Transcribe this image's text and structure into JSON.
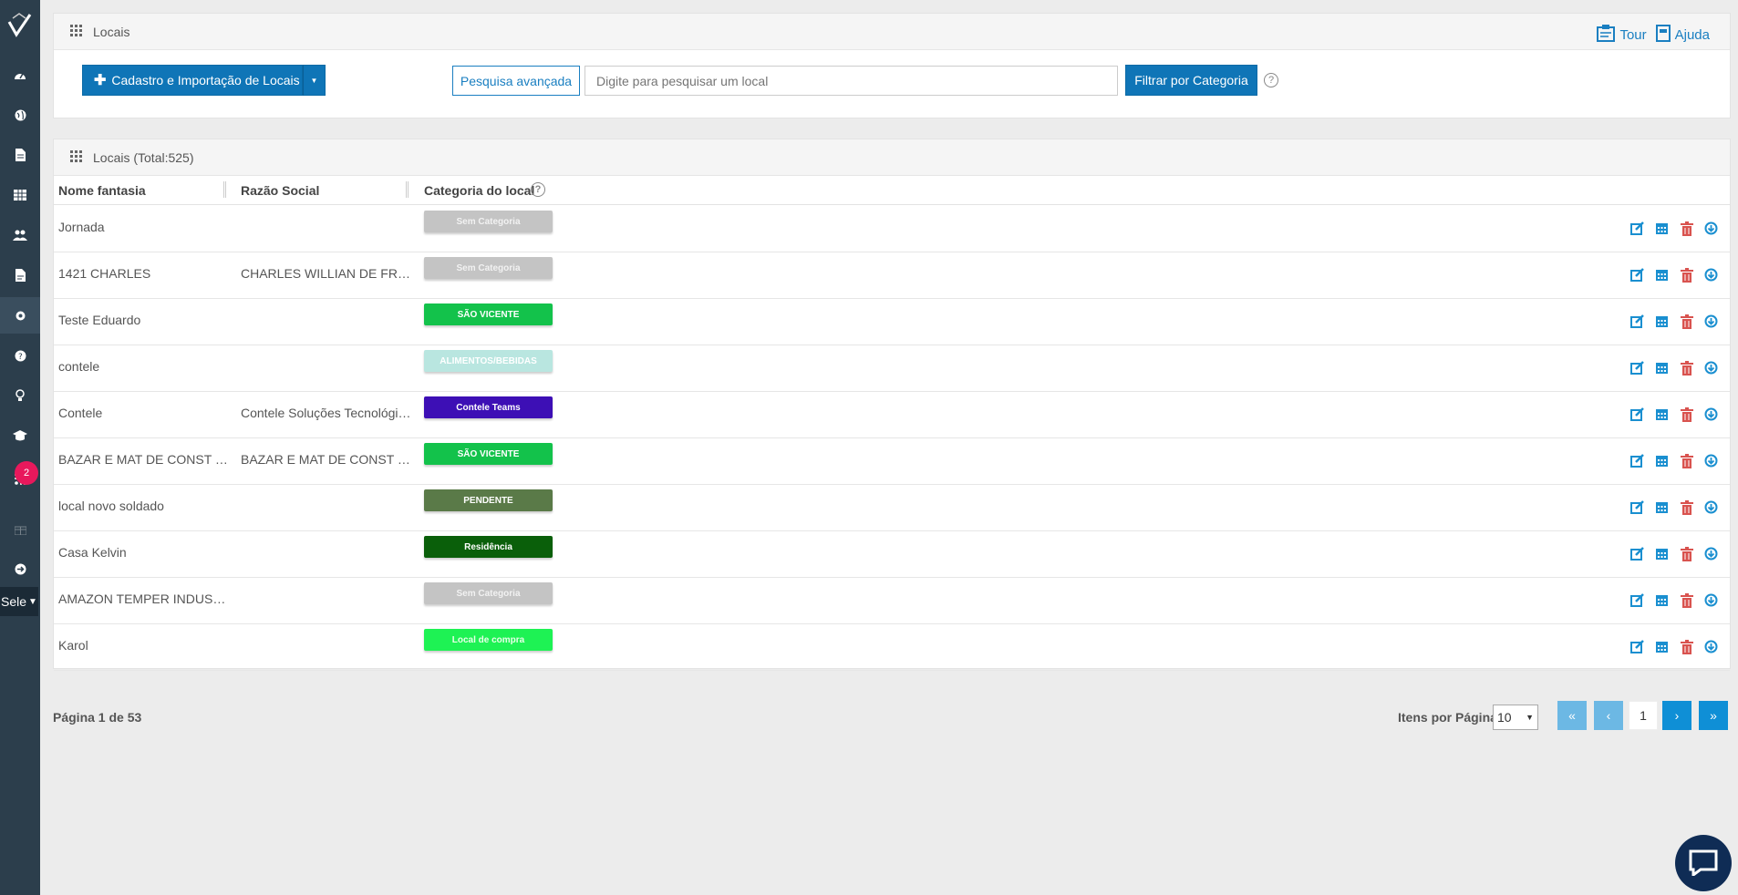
{
  "sidebar": {
    "items": [
      "dashboard-icon",
      "globe-icon",
      "document-icon",
      "table-icon",
      "users-icon",
      "report-icon",
      "gear-icon",
      "help-icon",
      "lightbulb-icon",
      "graduation-icon",
      "rss-icon",
      "gift-icon",
      "logout-icon"
    ],
    "badge": "2",
    "select_value": "Sele"
  },
  "locais_panel": {
    "title": "Locais",
    "tour_label": "Tour",
    "help_label": "Ajuda",
    "add_button_label": "Cadastro e Importação de Locais",
    "advanced_search_label": "Pesquisa avançada",
    "search_placeholder": "Digite para pesquisar um local",
    "filter_button_label": "Filtrar por Categoria"
  },
  "table": {
    "title": "Locais (Total:525)",
    "headers": {
      "name": "Nome fantasia",
      "razao": "Razão Social",
      "categoria": "Categoria do local"
    },
    "rows": [
      {
        "name": "Jornada",
        "razao": "",
        "category": "Sem Categoria",
        "cat_color": "#c4c4c4",
        "cat_text": "#f2f2f2"
      },
      {
        "name": "1421 CHARLES",
        "razao": "CHARLES WILLIAN DE FRANÇA",
        "category": "Sem Categoria",
        "cat_color": "#c4c4c4",
        "cat_text": "#f2f2f2"
      },
      {
        "name": "Teste Eduardo",
        "razao": "",
        "category": "SÃO VICENTE",
        "cat_color": "#13c24b",
        "cat_text": "#ffffff"
      },
      {
        "name": "contele",
        "razao": "",
        "category": "ALIMENTOS/BEBIDAS",
        "cat_color": "#b9e6e0",
        "cat_text": "#ffffff"
      },
      {
        "name": "Contele",
        "razao": "Contele Soluções Tecnológicas",
        "category": "Contele Teams",
        "cat_color": "#3d0fb5",
        "cat_text": "#ffffff"
      },
      {
        "name": "BAZAR E MAT DE CONST MARTINS",
        "razao": "BAZAR E MAT DE CONST MARTINS",
        "category": "SÃO VICENTE",
        "cat_color": "#13c24b",
        "cat_text": "#ffffff"
      },
      {
        "name": "local novo soldado",
        "razao": "",
        "category": "PENDENTE",
        "cat_color": "#5a7a48",
        "cat_text": "#ffffff"
      },
      {
        "name": "Casa Kelvin",
        "razao": "",
        "category": "Residência",
        "cat_color": "#0a5f0a",
        "cat_text": "#ffffff"
      },
      {
        "name": "AMAZON TEMPER INDUSTRIA",
        "razao": "",
        "category": "Sem Categoria",
        "cat_color": "#c4c4c4",
        "cat_text": "#f2f2f2"
      },
      {
        "name": "Karol",
        "razao": "",
        "category": "Local de compra",
        "cat_color": "#1ef254",
        "cat_text": "#e8ffe8"
      }
    ]
  },
  "pagination": {
    "page_info": "Página 1 de 53",
    "items_per_page_label": "Itens por Página:",
    "items_per_page": "10",
    "current_page": "1",
    "first": "«",
    "prev": "‹",
    "next": "›",
    "last": "»"
  },
  "colors": {
    "primary": "#0f75b7",
    "sidebar": "#2c3e4c",
    "edit": "#1a8fd0",
    "delete": "#d9534f"
  }
}
